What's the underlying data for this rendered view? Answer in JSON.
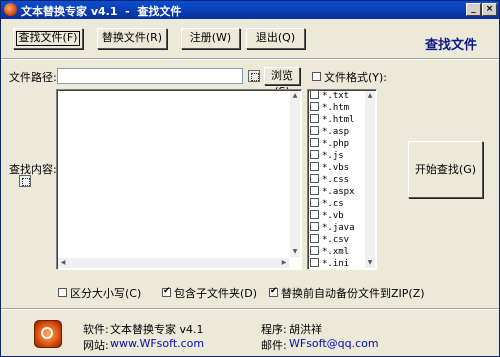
{
  "window": {
    "title": "文本替换专家 v4.1  -  查找文件",
    "min_label": "_",
    "close_label": "×"
  },
  "toolbar": {
    "find_files": "查找文件(F)",
    "replace_files": "替换文件(R)",
    "register": "注册(W)",
    "exit": "退出(Q)"
  },
  "page_heading": "查找文件",
  "path": {
    "label": "文件路径:",
    "value": "",
    "browse": "浏览(S)"
  },
  "content": {
    "label": "查找内容:",
    "value": ""
  },
  "file_format": {
    "label": "文件格式(Y):",
    "checked": false,
    "extensions": [
      "*.txt",
      "*.htm",
      "*.html",
      "*.asp",
      "*.php",
      "*.js",
      "*.vbs",
      "*.css",
      "*.aspx",
      "*.cs",
      "*.vb",
      "*.java",
      "*.csv",
      "*.xml",
      "*.ini"
    ]
  },
  "start_button": "开始查找(G)",
  "options": {
    "case_sensitive": {
      "label": "区分大小写(C)",
      "checked": false
    },
    "subfolders": {
      "label": "包含子文件夹(D)",
      "checked": true
    },
    "backup_zip": {
      "label": "替换前自动备份文件到ZIP(Z)",
      "checked": true
    }
  },
  "footer": {
    "software_label": "软件:",
    "software_value": "文本替换专家 v4.1",
    "website_label": "网站:",
    "website_value": "www.WFsoft.com",
    "author_label": "程序:",
    "author_value": "胡洪祥",
    "email_label": "邮件:",
    "email_value": "WFsoft@qq.com"
  },
  "colors": {
    "titlebar": "#0a3fb8",
    "heading": "#0b1a88",
    "link": "#0010b0"
  }
}
